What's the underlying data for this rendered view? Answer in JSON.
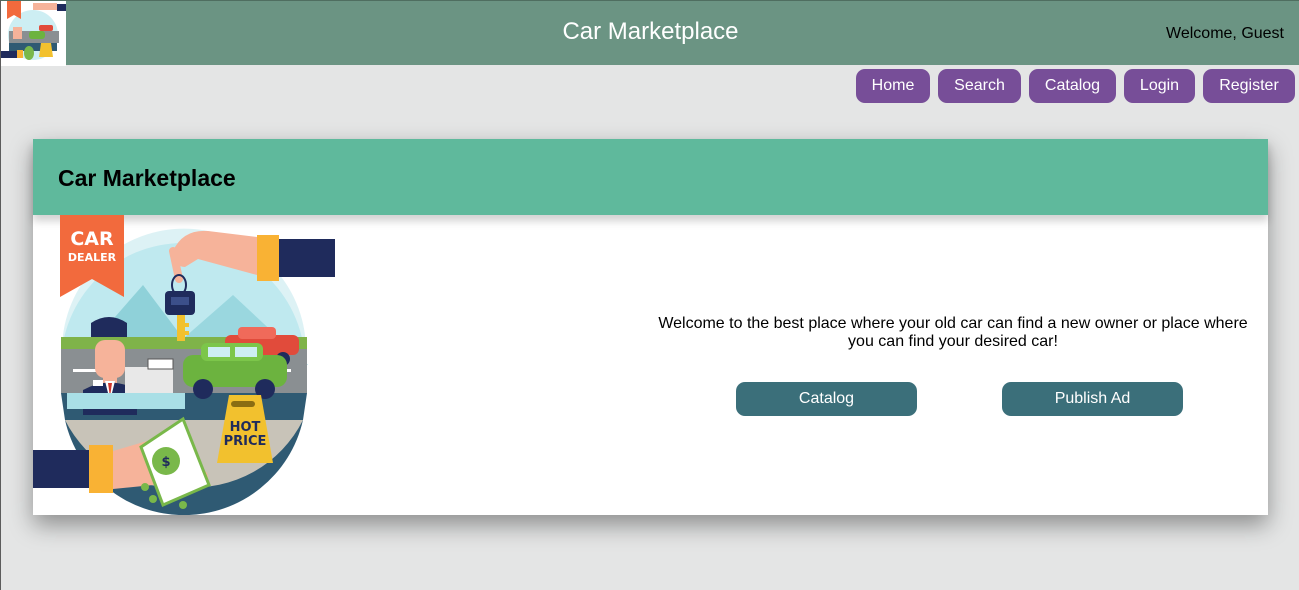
{
  "header": {
    "title": "Car Marketplace",
    "welcome": "Welcome, Guest",
    "logo_icon": "car-dealer-logo-icon"
  },
  "nav": {
    "items": [
      {
        "label": "Home"
      },
      {
        "label": "Search"
      },
      {
        "label": "Catalog"
      },
      {
        "label": "Login"
      },
      {
        "label": "Register"
      }
    ]
  },
  "hero": {
    "title": "Car Marketplace",
    "illustration": {
      "icon": "car-dealer-illustration",
      "badge_line1": "CAR",
      "badge_line2": "DEALER",
      "sign_line1": "HOT",
      "sign_line2": "PRICE",
      "money_symbol": "$"
    },
    "intro": "Welcome to the best place where your old car can find a new owner or place where you can find your desired car!",
    "catalog_button": "Catalog",
    "publish_button": "Publish Ad"
  },
  "colors": {
    "topbar": "#6b9483",
    "nav_button": "#774e98",
    "card_header": "#5fb99c",
    "action_button": "#3b6f7a",
    "page_background": "#e4e5e5"
  }
}
